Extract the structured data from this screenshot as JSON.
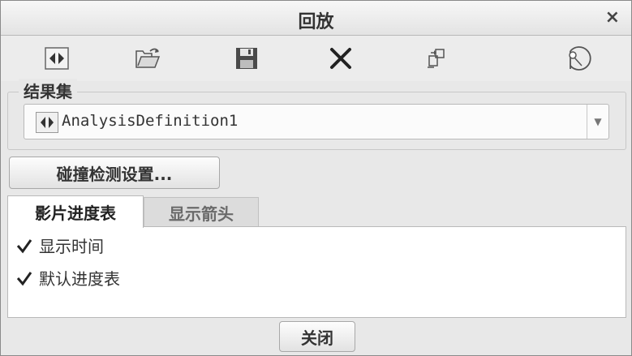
{
  "window": {
    "title": "回放",
    "close_glyph": "×"
  },
  "toolbar": {
    "buttons": [
      {
        "icon": "frames-icon"
      },
      {
        "icon": "open-folder-icon"
      },
      {
        "icon": "save-icon"
      },
      {
        "icon": "delete-icon"
      },
      {
        "icon": "export-icon"
      },
      {
        "icon": "collision-icon"
      }
    ]
  },
  "result_set": {
    "label": "结果集",
    "selected": "AnalysisDefinition1"
  },
  "collision_settings_label": "碰撞检测设置...",
  "tabs": [
    {
      "label": "影片进度表",
      "active": true
    },
    {
      "label": "显示箭头",
      "active": false
    }
  ],
  "options": [
    {
      "label": "显示时间",
      "checked": true
    },
    {
      "label": "默认进度表",
      "checked": true
    }
  ],
  "footer": {
    "close_label": "关闭"
  }
}
